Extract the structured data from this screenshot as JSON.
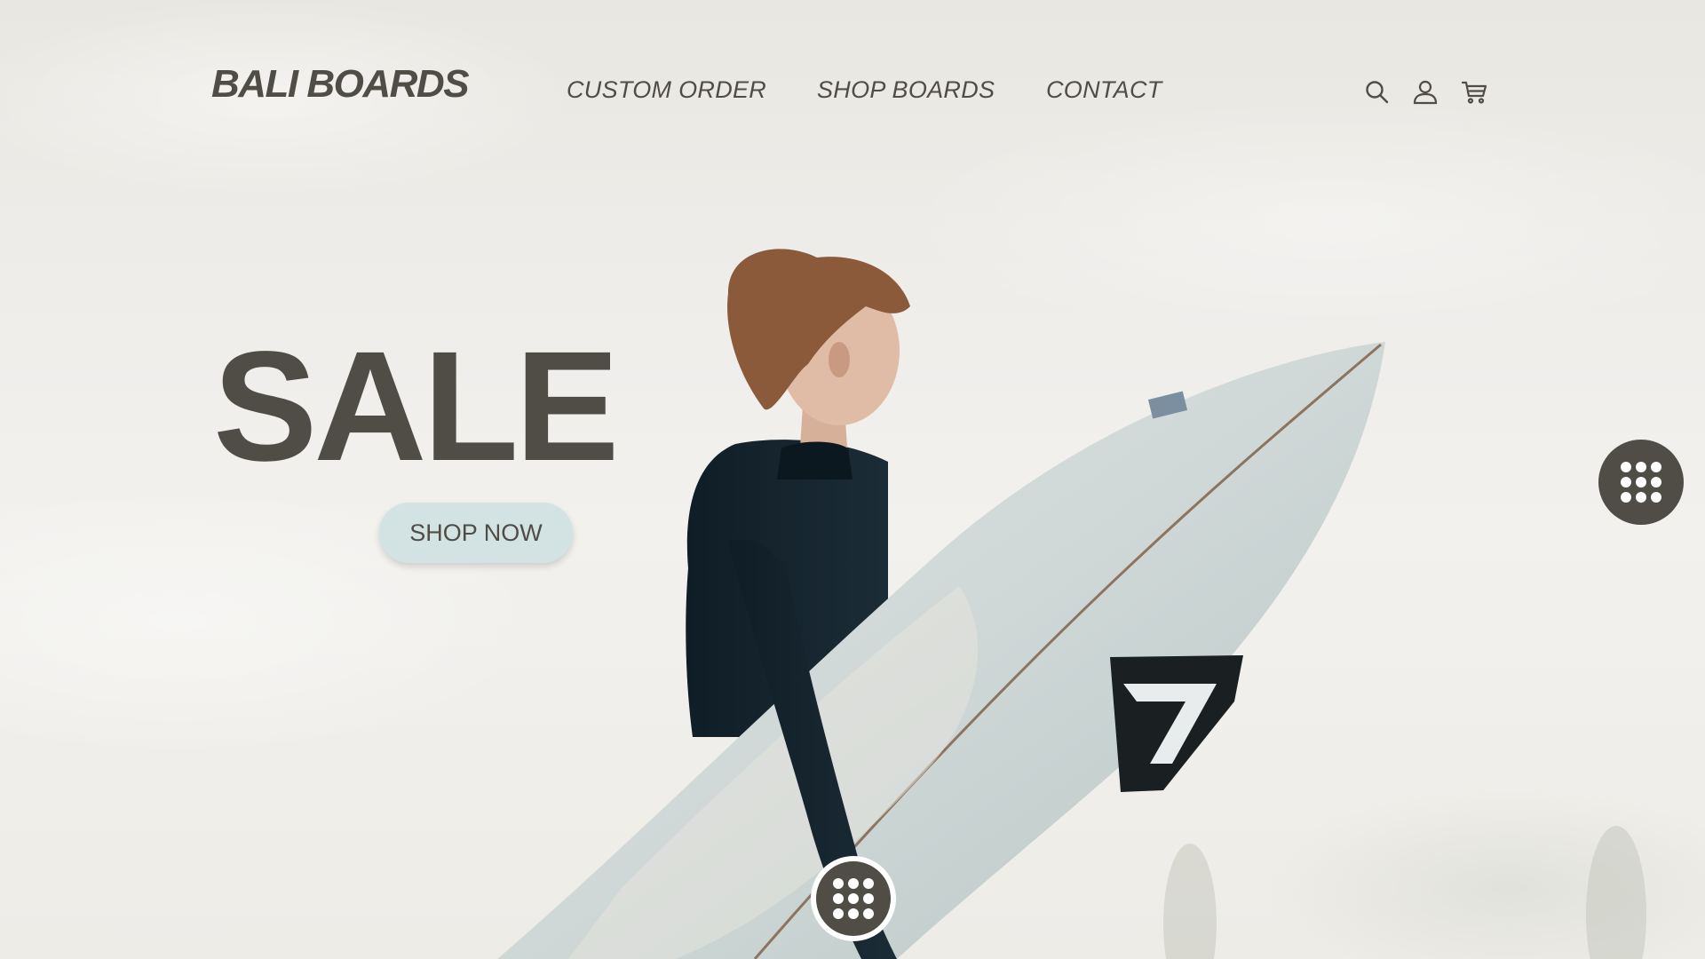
{
  "brand": {
    "name": "BALI BOARDS"
  },
  "nav": {
    "items": [
      {
        "label": "CUSTOM ORDER"
      },
      {
        "label": "SHOP BOARDS"
      },
      {
        "label": "CONTACT"
      }
    ]
  },
  "header_icons": [
    "search-icon",
    "user-icon",
    "cart-icon"
  ],
  "hero": {
    "headline": "SALE",
    "cta_label": "SHOP NOW"
  },
  "widgets": [
    "dots-grid-icon",
    "dots-grid-icon"
  ],
  "colors": {
    "text": "#4f4d45",
    "cta_background": "#d3e3e3",
    "widget_background": "#4f4d45",
    "page_background": "#efedea"
  }
}
